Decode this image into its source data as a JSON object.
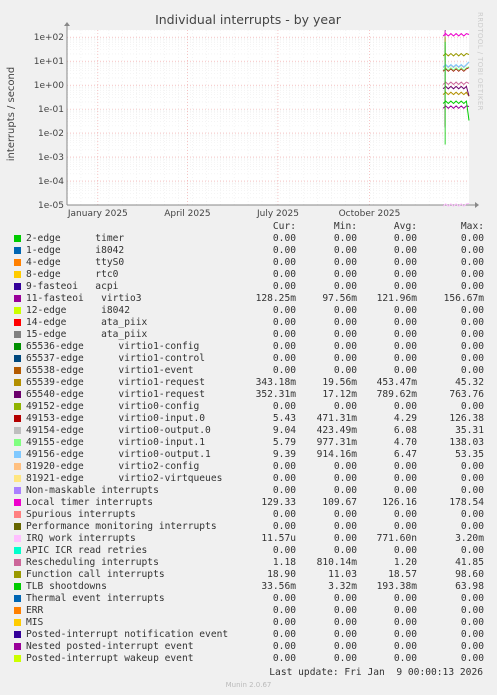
{
  "chart_data": {
    "type": "line",
    "title": "Individual interrupts - by year",
    "ylabel": "interrupts / second",
    "yscale": "log",
    "ylim": [
      1e-05,
      200
    ],
    "yticks": [
      {
        "value": 100,
        "label": "1e+02"
      },
      {
        "value": 10,
        "label": "1e+01"
      },
      {
        "value": 1,
        "label": "1e+00"
      },
      {
        "value": 0.1,
        "label": "1e-01"
      },
      {
        "value": 0.01,
        "label": "1e-02"
      },
      {
        "value": 0.001,
        "label": "1e-03"
      },
      {
        "value": 0.0001,
        "label": "1e-04"
      },
      {
        "value": 1e-05,
        "label": "1e-05"
      }
    ],
    "xticks": [
      {
        "date": "2025-01-01",
        "label": "January 2025"
      },
      {
        "date": "2025-04-01",
        "label": "April 2025"
      },
      {
        "date": "2025-07-01",
        "label": "July 2025"
      },
      {
        "date": "2025-10-01",
        "label": "October 2025"
      }
    ],
    "xrange": [
      "2024-12-01",
      "2026-01-09"
    ],
    "columns": [
      "Cur:",
      "Min:",
      "Avg:",
      "Max:"
    ],
    "series": [
      {
        "name": "2-edge      timer",
        "color": "#00cc00",
        "cur": "0.00",
        "min": "0.00",
        "avg": "0.00",
        "max": "0.00"
      },
      {
        "name": "1-edge      i8042",
        "color": "#0066b3",
        "cur": "0.00",
        "min": "0.00",
        "avg": "0.00",
        "max": "0.00"
      },
      {
        "name": "4-edge      ttyS0",
        "color": "#ff8000",
        "cur": "0.00",
        "min": "0.00",
        "avg": "0.00",
        "max": "0.00"
      },
      {
        "name": "8-edge      rtc0",
        "color": "#ffcc00",
        "cur": "0.00",
        "min": "0.00",
        "avg": "0.00",
        "max": "0.00"
      },
      {
        "name": "9-fasteoi   acpi",
        "color": "#330099",
        "cur": "0.00",
        "min": "0.00",
        "avg": "0.00",
        "max": "0.00"
      },
      {
        "name": "11-fasteoi   virtio3",
        "color": "#990099",
        "cur": "128.25m",
        "min": "97.56m",
        "avg": "121.96m",
        "max": "156.67m"
      },
      {
        "name": "12-edge      i8042",
        "color": "#ccff00",
        "cur": "0.00",
        "min": "0.00",
        "avg": "0.00",
        "max": "0.00"
      },
      {
        "name": "14-edge      ata_piix",
        "color": "#ff0000",
        "cur": "0.00",
        "min": "0.00",
        "avg": "0.00",
        "max": "0.00"
      },
      {
        "name": "15-edge      ata_piix",
        "color": "#808080",
        "cur": "0.00",
        "min": "0.00",
        "avg": "0.00",
        "max": "0.00"
      },
      {
        "name": "65536-edge      virtio1-config",
        "color": "#008f00",
        "cur": "0.00",
        "min": "0.00",
        "avg": "0.00",
        "max": "0.00"
      },
      {
        "name": "65537-edge      virtio1-control",
        "color": "#00487d",
        "cur": "0.00",
        "min": "0.00",
        "avg": "0.00",
        "max": "0.00"
      },
      {
        "name": "65538-edge      virtio1-event",
        "color": "#b35a00",
        "cur": "0.00",
        "min": "0.00",
        "avg": "0.00",
        "max": "0.00"
      },
      {
        "name": "65539-edge      virtio1-request",
        "color": "#b38f00",
        "cur": "343.18m",
        "min": "19.56m",
        "avg": "453.47m",
        "max": "45.32"
      },
      {
        "name": "65540-edge      virtio1-request",
        "color": "#6b006b",
        "cur": "352.31m",
        "min": "17.12m",
        "avg": "789.62m",
        "max": "763.76"
      },
      {
        "name": "49152-edge      virtio0-config",
        "color": "#8fb300",
        "cur": "0.00",
        "min": "0.00",
        "avg": "0.00",
        "max": "0.00"
      },
      {
        "name": "49153-edge      virtio0-input.0",
        "color": "#b30000",
        "cur": "5.43",
        "min": "471.31m",
        "avg": "4.29",
        "max": "126.38"
      },
      {
        "name": "49154-edge      virtio0-output.0",
        "color": "#bebebe",
        "cur": "9.04",
        "min": "423.49m",
        "avg": "6.08",
        "max": "35.31"
      },
      {
        "name": "49155-edge      virtio0-input.1",
        "color": "#80ff80",
        "cur": "5.79",
        "min": "977.31m",
        "avg": "4.70",
        "max": "138.03"
      },
      {
        "name": "49156-edge      virtio0-output.1",
        "color": "#80c9ff",
        "cur": "9.39",
        "min": "914.16m",
        "avg": "6.47",
        "max": "53.35"
      },
      {
        "name": "81920-edge      virtio2-config",
        "color": "#ffc080",
        "cur": "0.00",
        "min": "0.00",
        "avg": "0.00",
        "max": "0.00"
      },
      {
        "name": "81921-edge      virtio2-virtqueues",
        "color": "#ffe680",
        "cur": "0.00",
        "min": "0.00",
        "avg": "0.00",
        "max": "0.00"
      },
      {
        "name": "Non-maskable interrupts",
        "color": "#aa80ff",
        "cur": "0.00",
        "min": "0.00",
        "avg": "0.00",
        "max": "0.00"
      },
      {
        "name": "Local timer interrupts",
        "color": "#ee00cc",
        "cur": "129.33",
        "min": "109.67",
        "avg": "126.16",
        "max": "178.54"
      },
      {
        "name": "Spurious interrupts",
        "color": "#ff8080",
        "cur": "0.00",
        "min": "0.00",
        "avg": "0.00",
        "max": "0.00"
      },
      {
        "name": "Performance monitoring interrupts",
        "color": "#666600",
        "cur": "0.00",
        "min": "0.00",
        "avg": "0.00",
        "max": "0.00"
      },
      {
        "name": "IRQ work interrupts",
        "color": "#ffbfff",
        "cur": "11.57u",
        "min": "0.00",
        "avg": "771.60n",
        "max": "3.20m"
      },
      {
        "name": "APIC ICR read retries",
        "color": "#00ffcc",
        "cur": "0.00",
        "min": "0.00",
        "avg": "0.00",
        "max": "0.00"
      },
      {
        "name": "Rescheduling interrupts",
        "color": "#cc6699",
        "cur": "1.18",
        "min": "810.14m",
        "avg": "1.20",
        "max": "41.85"
      },
      {
        "name": "Function call interrupts",
        "color": "#999900",
        "cur": "18.90",
        "min": "11.03",
        "avg": "18.57",
        "max": "98.60"
      },
      {
        "name": "TLB shootdowns",
        "color": "#00cc00",
        "cur": "33.56m",
        "min": "3.32m",
        "avg": "193.38m",
        "max": "63.98"
      },
      {
        "name": "Thermal event interrupts",
        "color": "#0066b3",
        "cur": "0.00",
        "min": "0.00",
        "avg": "0.00",
        "max": "0.00"
      },
      {
        "name": "ERR",
        "color": "#ff8000",
        "cur": "0.00",
        "min": "0.00",
        "avg": "0.00",
        "max": "0.00"
      },
      {
        "name": "MIS",
        "color": "#ffcc00",
        "cur": "0.00",
        "min": "0.00",
        "avg": "0.00",
        "max": "0.00"
      },
      {
        "name": "Posted-interrupt notification event",
        "color": "#330099",
        "cur": "0.00",
        "min": "0.00",
        "avg": "0.00",
        "max": "0.00"
      },
      {
        "name": "Nested posted-interrupt event",
        "color": "#990099",
        "cur": "0.00",
        "min": "0.00",
        "avg": "0.00",
        "max": "0.00"
      },
      {
        "name": "Posted-interrupt wakeup event",
        "color": "#ccff00",
        "cur": "0.00",
        "min": "0.00",
        "avg": "0.00",
        "max": "0.00"
      }
    ]
  },
  "footer": {
    "last_update": "Last update: Fri Jan  9 00:00:13 2026",
    "munin": "Munin 2.0.67",
    "watermark": "RRDTOOL / TOBI OETIKER"
  }
}
